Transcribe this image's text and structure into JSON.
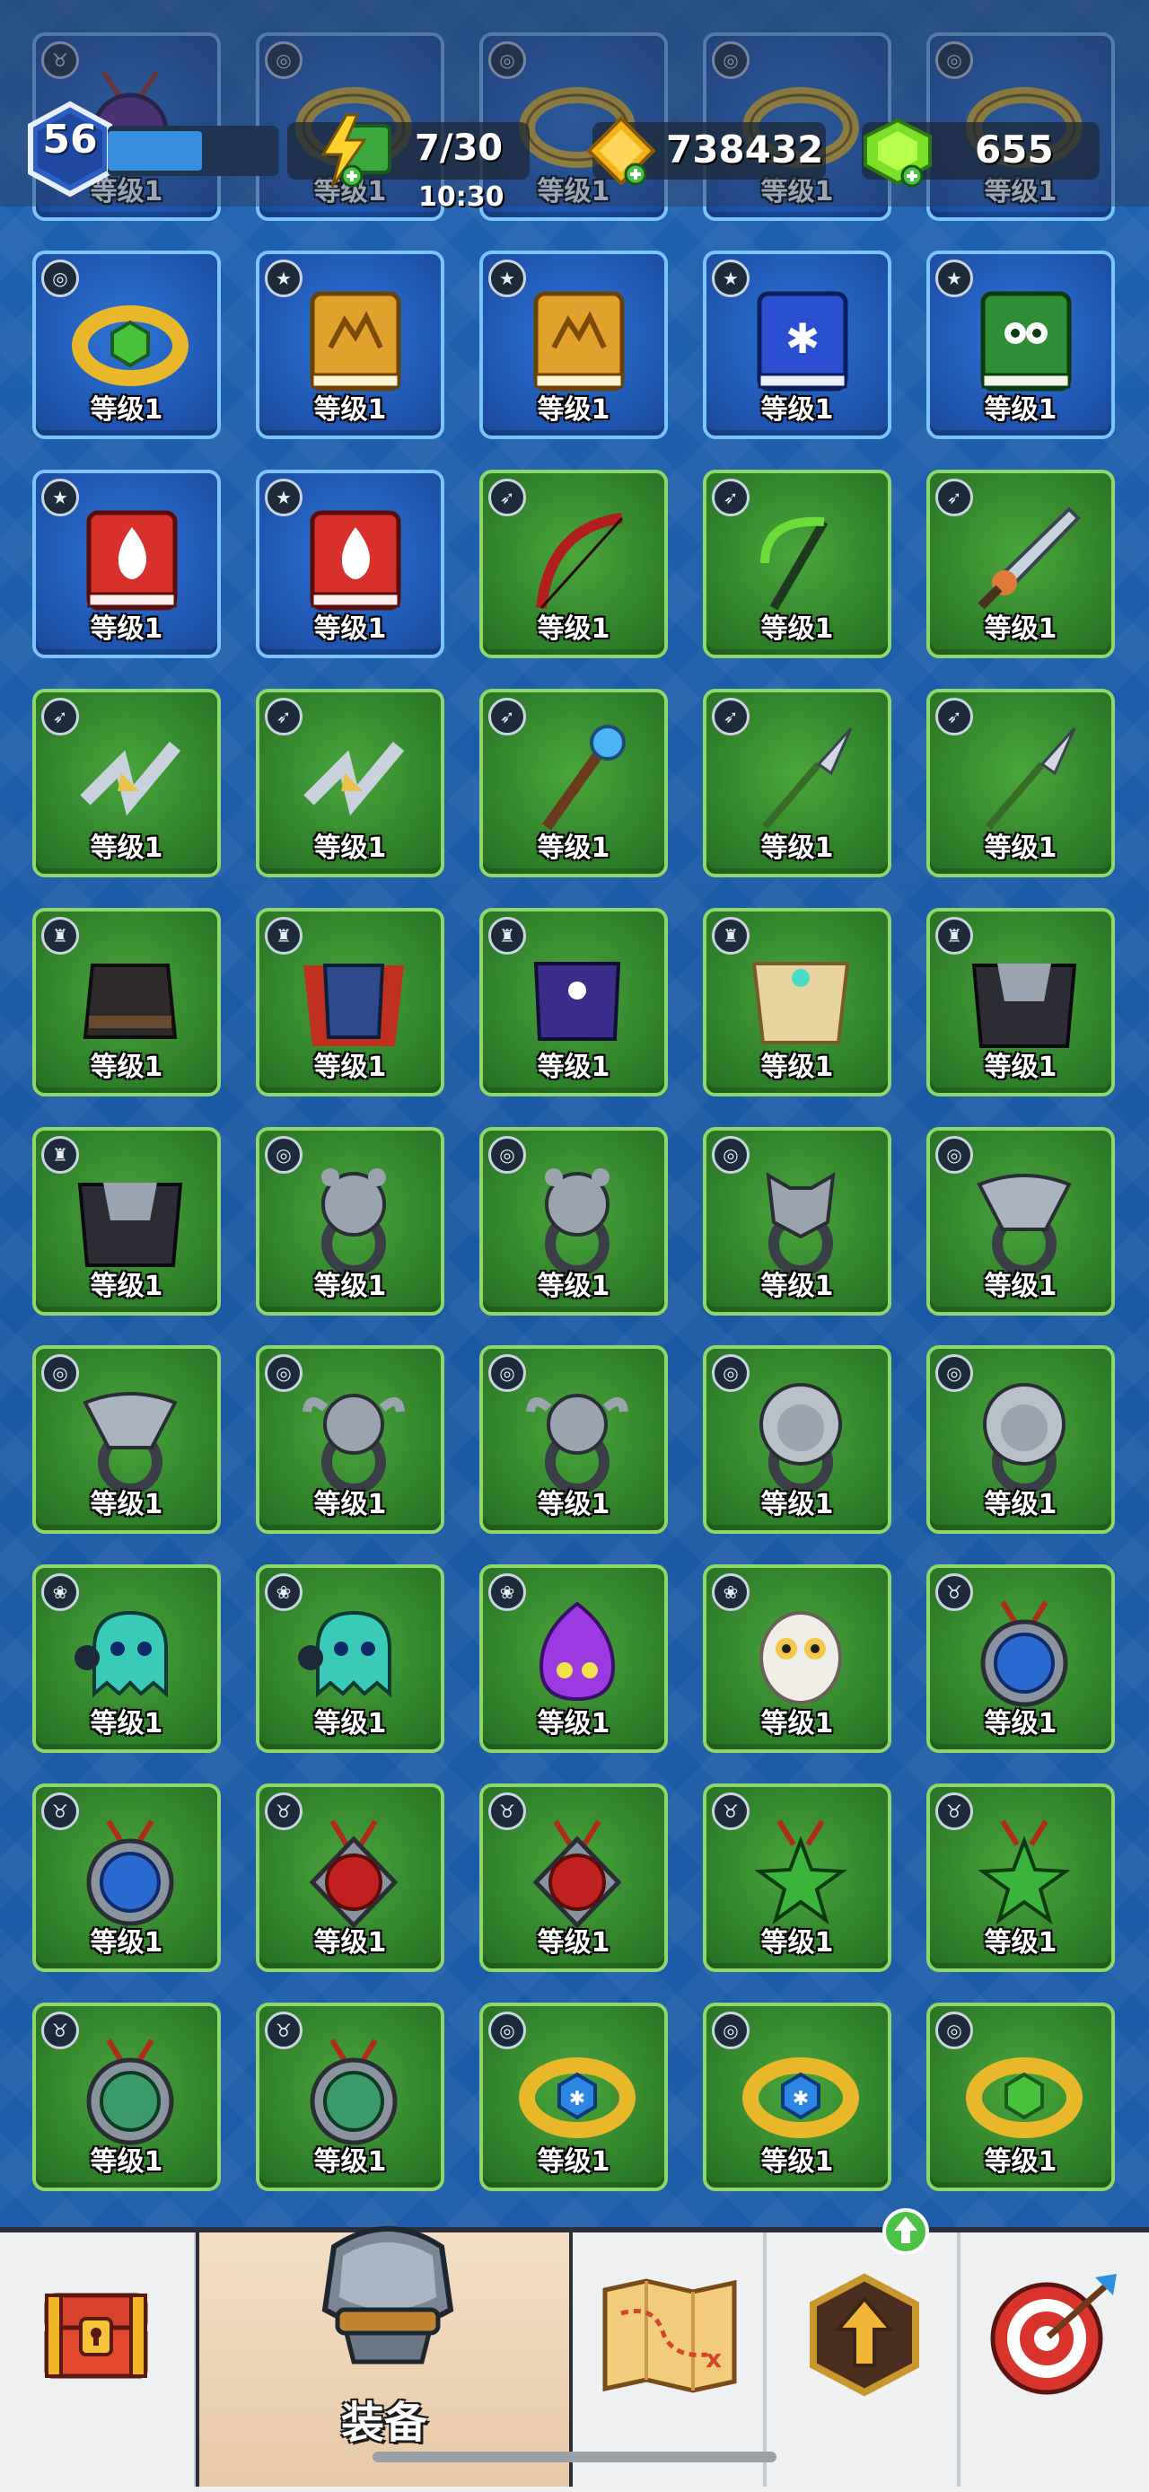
{
  "hud": {
    "player_level": "56",
    "xp_progress": 0.55,
    "energy": "7/30",
    "energy_timer": "10:30",
    "gold": "738432",
    "gems": "655"
  },
  "inventory": {
    "level_label": "等级1",
    "rows": [
      [
        {
          "t": "blue",
          "c": "neck",
          "a": "amulet-purple"
        },
        {
          "t": "blue",
          "c": "ring",
          "a": "bracelet"
        },
        {
          "t": "blue",
          "c": "ring",
          "a": "bracelet"
        },
        {
          "t": "blue",
          "c": "ring",
          "a": "bracelet"
        },
        {
          "t": "blue",
          "c": "ring",
          "a": "bracelet"
        }
      ],
      [
        {
          "t": "blue",
          "c": "ring",
          "a": "bracelet-green"
        },
        {
          "t": "blue",
          "c": "book",
          "a": "book-gold"
        },
        {
          "t": "blue",
          "c": "book",
          "a": "book-gold"
        },
        {
          "t": "blue",
          "c": "book",
          "a": "book-ice"
        },
        {
          "t": "blue",
          "c": "book",
          "a": "book-owl"
        }
      ],
      [
        {
          "t": "blue",
          "c": "book",
          "a": "book-fire"
        },
        {
          "t": "blue",
          "c": "book",
          "a": "book-fire"
        },
        {
          "t": "green",
          "c": "weapon",
          "a": "bow-red"
        },
        {
          "t": "green",
          "c": "weapon",
          "a": "scythe"
        },
        {
          "t": "green",
          "c": "weapon",
          "a": "sword-spiked"
        }
      ],
      [
        {
          "t": "green",
          "c": "weapon",
          "a": "shuriken"
        },
        {
          "t": "green",
          "c": "weapon",
          "a": "shuriken"
        },
        {
          "t": "green",
          "c": "weapon",
          "a": "staff"
        },
        {
          "t": "green",
          "c": "weapon",
          "a": "spear"
        },
        {
          "t": "green",
          "c": "weapon",
          "a": "spear"
        }
      ],
      [
        {
          "t": "green",
          "c": "armor",
          "a": "armor-dark"
        },
        {
          "t": "green",
          "c": "armor",
          "a": "armor-red"
        },
        {
          "t": "green",
          "c": "armor",
          "a": "armor-purple"
        },
        {
          "t": "green",
          "c": "armor",
          "a": "armor-gold"
        },
        {
          "t": "green",
          "c": "armor",
          "a": "armor-shadow"
        }
      ],
      [
        {
          "t": "green",
          "c": "armor",
          "a": "armor-shadow"
        },
        {
          "t": "green",
          "c": "ring",
          "a": "ring-bear"
        },
        {
          "t": "green",
          "c": "ring",
          "a": "ring-bear"
        },
        {
          "t": "green",
          "c": "ring",
          "a": "ring-wolf"
        },
        {
          "t": "green",
          "c": "ring",
          "a": "ring-eagle"
        }
      ],
      [
        {
          "t": "green",
          "c": "ring",
          "a": "ring-eagle"
        },
        {
          "t": "green",
          "c": "ring",
          "a": "ring-bull"
        },
        {
          "t": "green",
          "c": "ring",
          "a": "ring-bull"
        },
        {
          "t": "green",
          "c": "ring",
          "a": "ring-lion"
        },
        {
          "t": "green",
          "c": "ring",
          "a": "ring-lion"
        }
      ],
      [
        {
          "t": "green",
          "c": "pet",
          "a": "pet-ghost"
        },
        {
          "t": "green",
          "c": "pet",
          "a": "pet-ghost"
        },
        {
          "t": "green",
          "c": "pet",
          "a": "pet-flame"
        },
        {
          "t": "green",
          "c": "pet",
          "a": "pet-owl"
        },
        {
          "t": "green",
          "c": "neck",
          "a": "amulet-moon"
        }
      ],
      [
        {
          "t": "green",
          "c": "neck",
          "a": "amulet-moon"
        },
        {
          "t": "green",
          "c": "neck",
          "a": "amulet-wolf-red"
        },
        {
          "t": "green",
          "c": "neck",
          "a": "amulet-wolf-red"
        },
        {
          "t": "green",
          "c": "neck",
          "a": "amulet-star-green"
        },
        {
          "t": "green",
          "c": "neck",
          "a": "amulet-star-green"
        }
      ],
      [
        {
          "t": "green",
          "c": "neck",
          "a": "amulet-monkey"
        },
        {
          "t": "green",
          "c": "neck",
          "a": "amulet-monkey"
        },
        {
          "t": "green",
          "c": "ring",
          "a": "bracelet-ice"
        },
        {
          "t": "green",
          "c": "ring",
          "a": "bracelet-ice"
        },
        {
          "t": "green",
          "c": "ring",
          "a": "bracelet-green"
        }
      ]
    ]
  },
  "nav": {
    "equipment_label": "装备"
  },
  "colors": {
    "green_tile": "#2f7f2a",
    "blue_tile": "#1f55b0",
    "background": "#1c5ba6"
  }
}
